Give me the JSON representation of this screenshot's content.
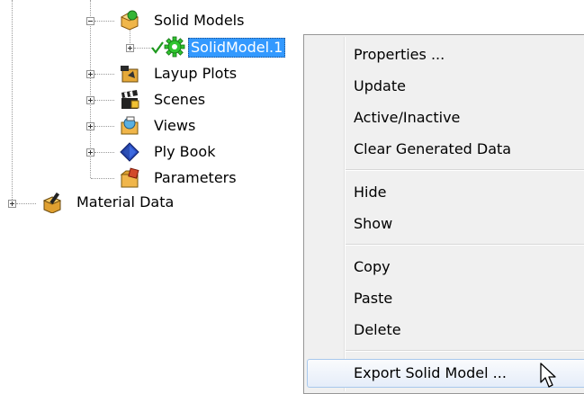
{
  "tree": {
    "solid_models": {
      "label": "Solid Models"
    },
    "solid_model_1": {
      "label": "SolidModel.1",
      "status": "active-check"
    },
    "layup_plots": {
      "label": "Layup Plots"
    },
    "scenes": {
      "label": "Scenes"
    },
    "views": {
      "label": "Views"
    },
    "ply_book": {
      "label": "Ply Book"
    },
    "parameters": {
      "label": "Parameters"
    },
    "material_data": {
      "label": "Material Data"
    }
  },
  "context_menu": {
    "groups": [
      [
        "Properties ...",
        "Update",
        "Active/Inactive",
        "Clear Generated Data"
      ],
      [
        "Hide",
        "Show"
      ],
      [
        "Copy",
        "Paste",
        "Delete"
      ],
      [
        "Export Solid Model ..."
      ]
    ],
    "hovered_item": "Export Solid Model ..."
  },
  "colors": {
    "selection": "#3399ff",
    "menu_background": "#f0f0f0",
    "menu_hover": "#e5edf9"
  }
}
